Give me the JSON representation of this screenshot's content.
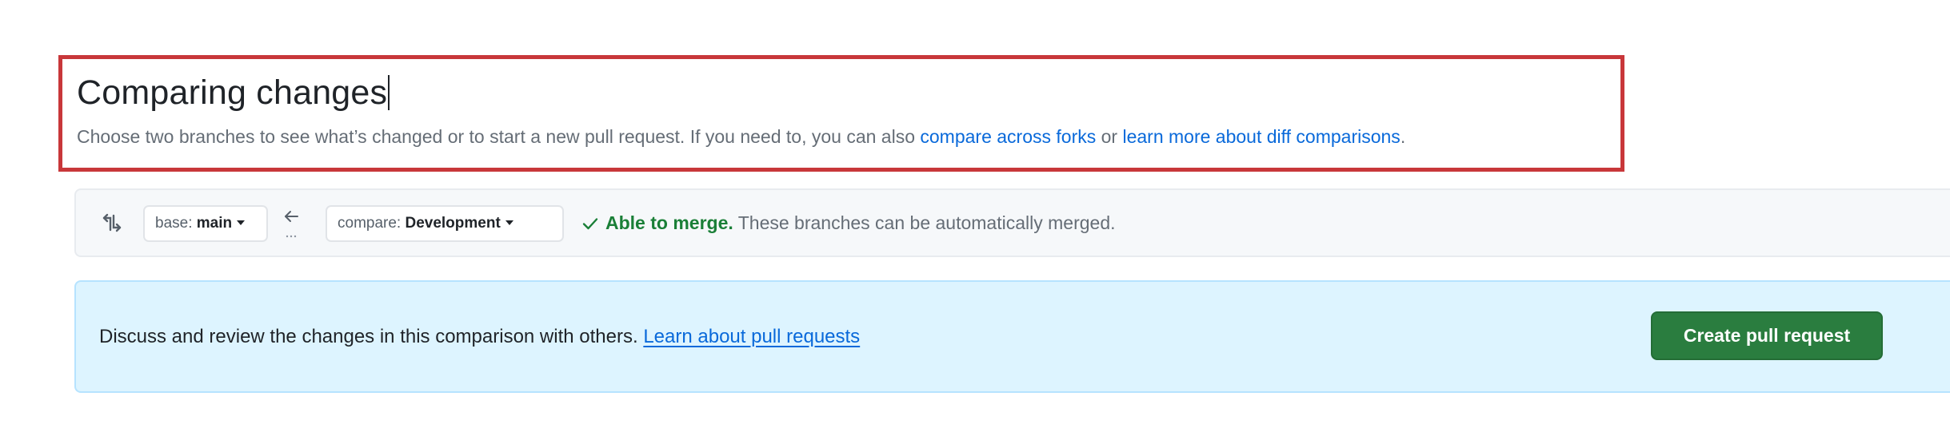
{
  "header": {
    "title": "Comparing changes",
    "subtitle_before": "Choose two branches to see what’s changed or to start a new pull request. If you need to, you can also ",
    "link_forks": "compare across forks",
    "subtitle_between": " or ",
    "link_diff": "learn more about diff comparisons",
    "subtitle_after": "."
  },
  "compare": {
    "icon": "compare-arrows-icon",
    "base_prefix": "base: ",
    "base_branch": "main",
    "arrow": "left-arrow-icon",
    "compare_prefix": "compare: ",
    "compare_branch": "Development",
    "merge_ok": "Able to merge.",
    "merge_text": " These branches can be automatically merged."
  },
  "banner": {
    "text": "Discuss and review the changes in this comparison with others. ",
    "link": "Learn about pull requests",
    "button": "Create pull request"
  },
  "colors": {
    "highlight_border": "#c8373a",
    "link": "#0969da",
    "success": "#1a7f37",
    "banner_bg": "#ddf4ff",
    "button_bg": "#2a7d3f"
  }
}
